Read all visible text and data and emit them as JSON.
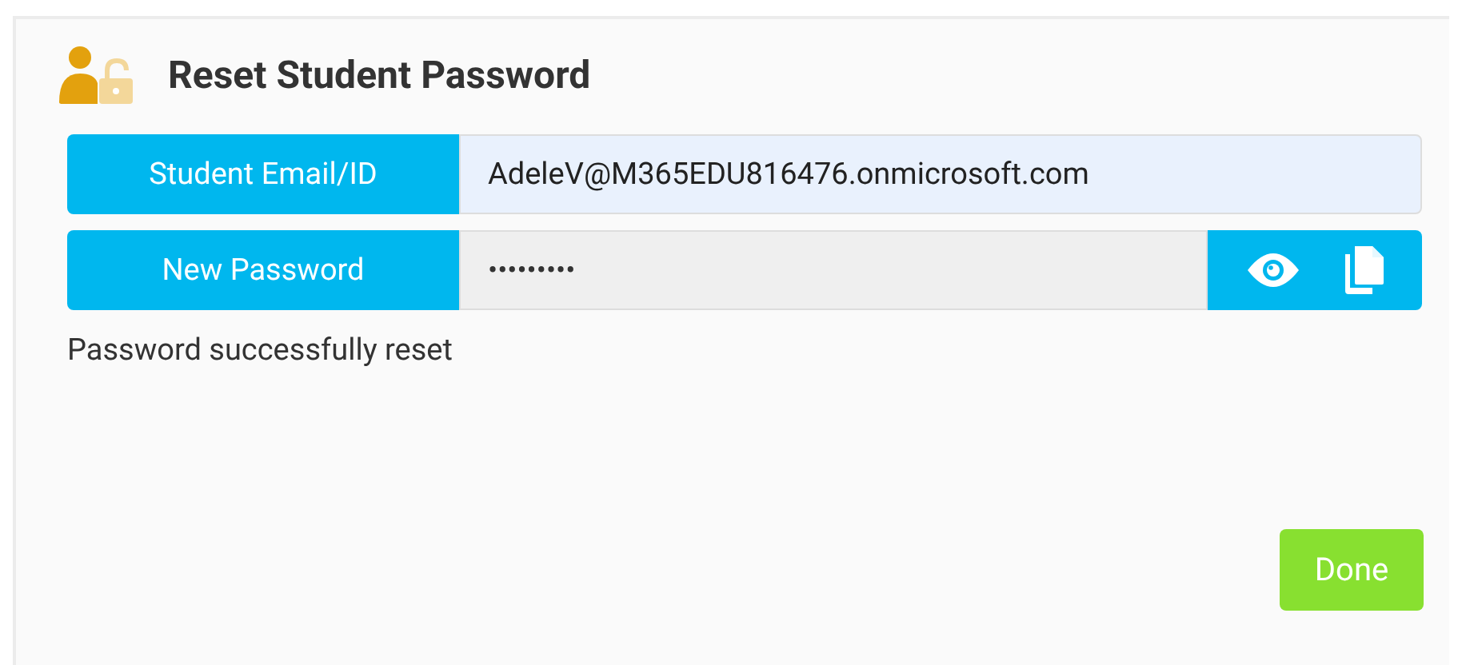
{
  "dialog": {
    "title": "Reset Student Password"
  },
  "fields": [
    {
      "kind": "email",
      "label": "Student Email/ID",
      "value": "AdeleV@M365EDU816476.onmicrosoft.com"
    },
    {
      "kind": "password",
      "label": "New Password",
      "value": "•••••••••"
    }
  ],
  "status": "Password successfully reset",
  "buttons": {
    "done": "Done"
  }
}
